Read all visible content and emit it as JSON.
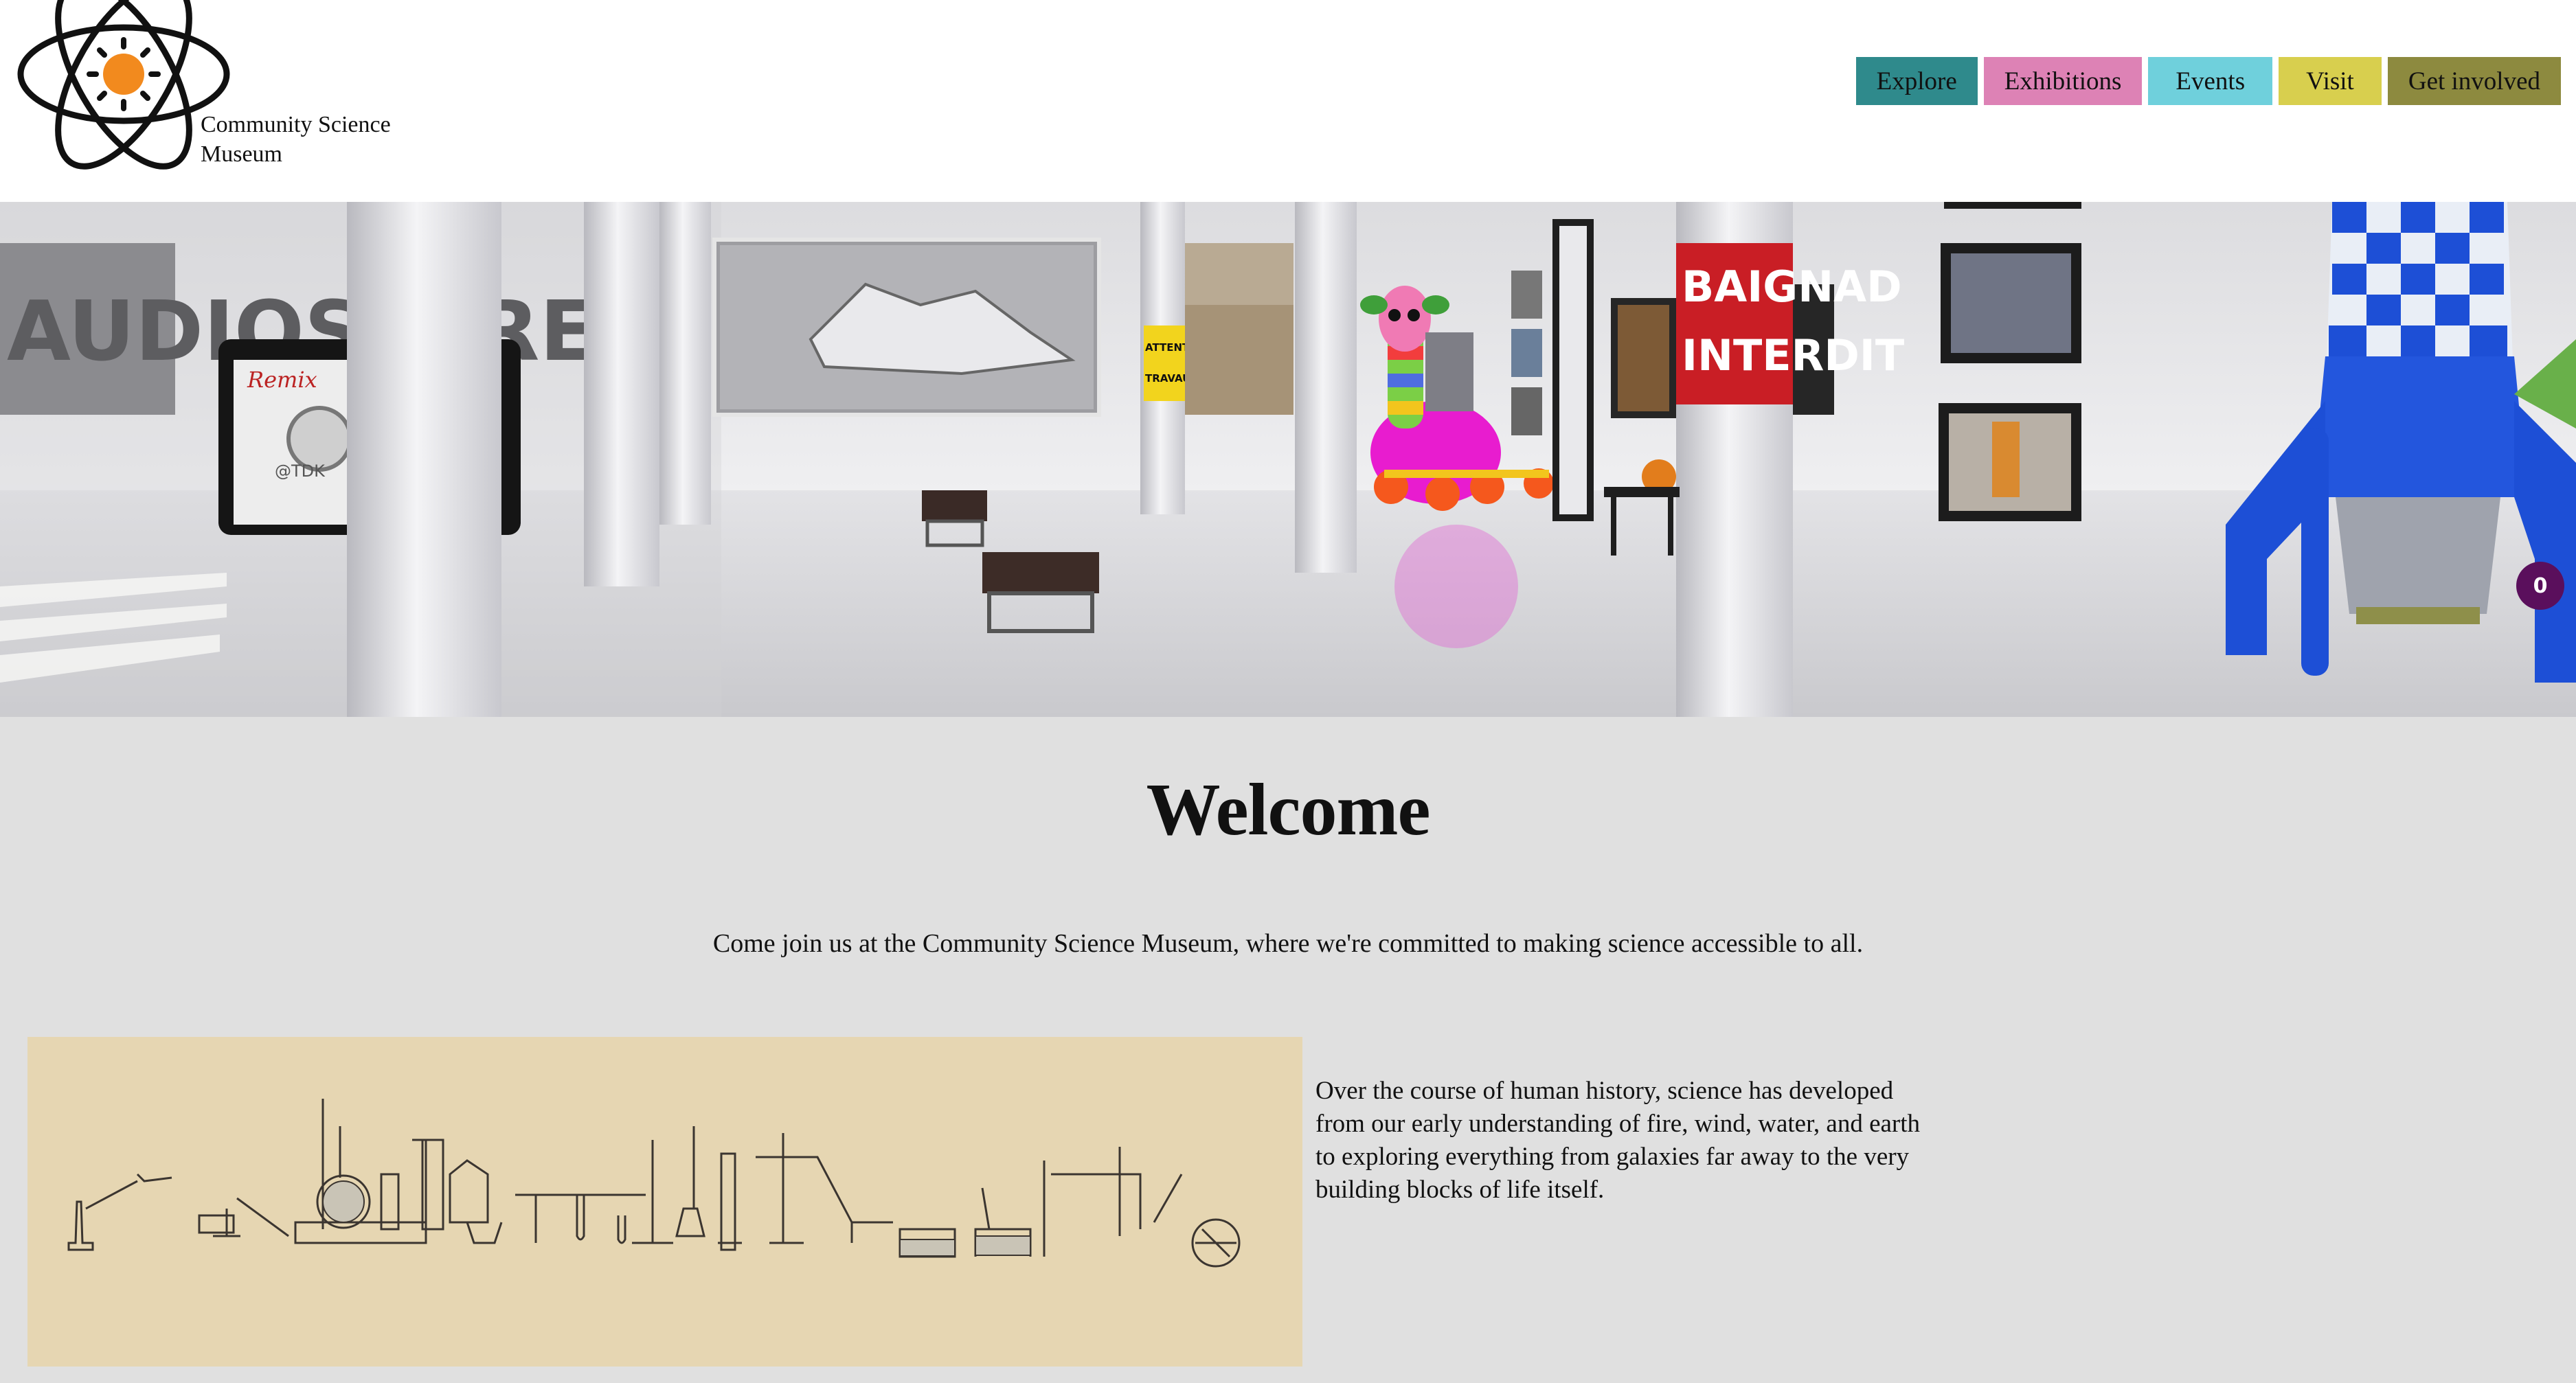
{
  "brand": {
    "name": "Community Science Museum"
  },
  "nav": [
    {
      "label": "Explore",
      "color": "#2f8a8c"
    },
    {
      "label": "Exhibitions",
      "color": "#dd82b5"
    },
    {
      "label": "Events",
      "color": "#6fd0dc"
    },
    {
      "label": "Visit",
      "color": "#d8cf4e"
    },
    {
      "label": "Get involved",
      "color": "#8d8a3f"
    }
  ],
  "hero": {
    "signs": {
      "cassette_brand": "Remix",
      "cassette_maker": "@TDK",
      "caution_line1": "ATTENTION",
      "caution_line2": "TRAVAUX",
      "red_banner_line1": "BAIGNAD",
      "red_banner_line2": "INTERDIT",
      "side_lettering": "AUDIOSTEREO"
    },
    "cart_count": "0"
  },
  "welcome": {
    "title": "Welcome",
    "subtitle": "Come join us at the Community Science Museum, where we're committed to making science accessible to all."
  },
  "history": {
    "text": "Over the course of human history, science has developed from our early understanding of fire, wind, water, and earth to exploring everything from galaxies far away to the very building blocks of life itself."
  },
  "colors": {
    "page_bg": "#e0e0e0",
    "lab_panel_bg": "#e6d6b2",
    "badge_bg": "#5a0f5c",
    "logo_orange": "#f28a1e"
  }
}
